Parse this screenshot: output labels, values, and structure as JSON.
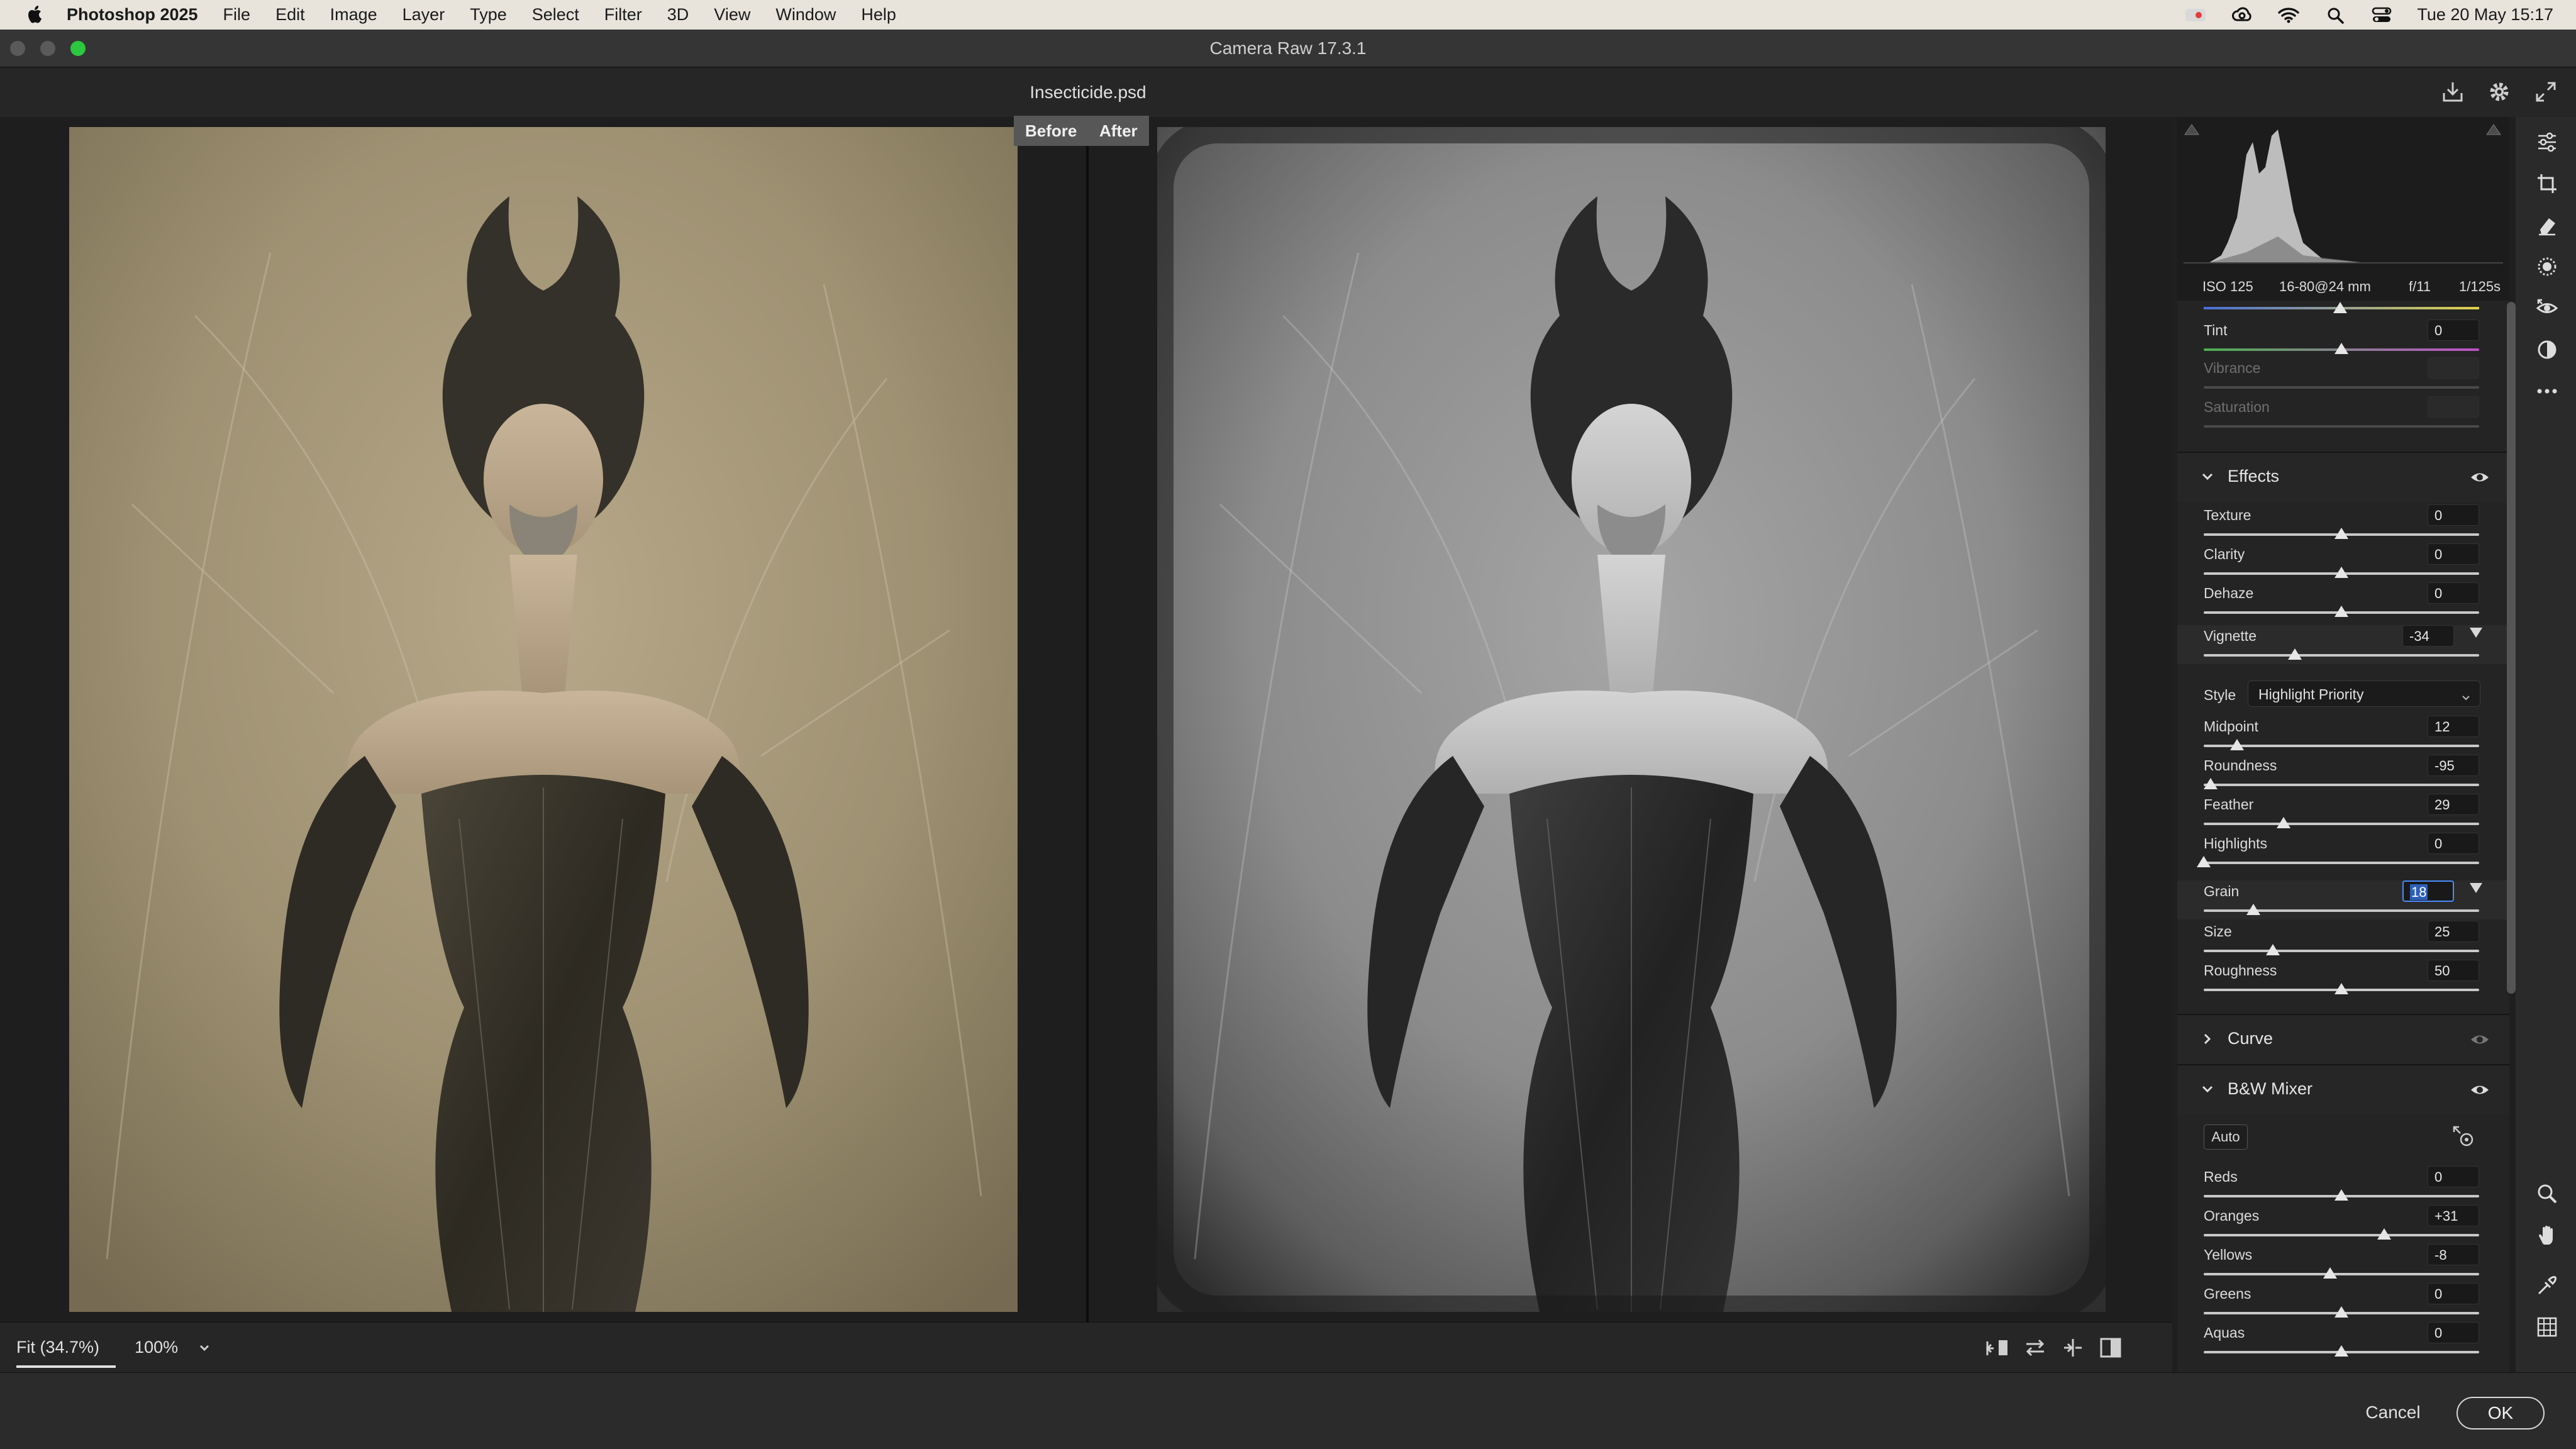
{
  "menubar": {
    "apple_icon": "apple-icon",
    "app_name": "Photoshop 2025",
    "items": [
      "File",
      "Edit",
      "Image",
      "Layer",
      "Type",
      "Select",
      "Filter",
      "3D",
      "View",
      "Window",
      "Help"
    ],
    "clock": "Tue 20 May  15:17"
  },
  "window": {
    "title": "Camera Raw 17.3.1"
  },
  "document": {
    "filename": "Insecticide.psd"
  },
  "compare": {
    "before": "Before",
    "after": "After"
  },
  "camera": {
    "iso": "ISO 125",
    "lens": "16-80@24 mm",
    "aperture": "f/11",
    "shutter": "1/125s"
  },
  "basic_tail": [
    {
      "label": "Tint",
      "value": "0",
      "position": 0.5,
      "enabled": true
    },
    {
      "label": "Vibrance",
      "value": "",
      "position": null,
      "enabled": false
    },
    {
      "label": "Saturation",
      "value": "",
      "position": null,
      "enabled": false
    }
  ],
  "effects": {
    "title": "Effects",
    "sliders": [
      {
        "label": "Texture",
        "value": "0",
        "position": 0.5
      },
      {
        "label": "Clarity",
        "value": "0",
        "position": 0.5
      },
      {
        "label": "Dehaze",
        "value": "0",
        "position": 0.5
      }
    ],
    "vignette": {
      "label": "Vignette",
      "value": "-34",
      "position": 0.33
    },
    "style": {
      "label": "Style",
      "value": "Highlight Priority"
    },
    "vignette_sub": [
      {
        "label": "Midpoint",
        "value": "12",
        "position": 0.12
      },
      {
        "label": "Roundness",
        "value": "-95",
        "position": 0.025
      },
      {
        "label": "Feather",
        "value": "29",
        "position": 0.29
      },
      {
        "label": "Highlights",
        "value": "0",
        "position": 0.0
      }
    ],
    "grain": {
      "label": "Grain",
      "value": "18",
      "position": 0.18
    },
    "grain_sub": [
      {
        "label": "Size",
        "value": "25",
        "position": 0.25
      },
      {
        "label": "Roughness",
        "value": "50",
        "position": 0.5
      }
    ]
  },
  "curve": {
    "title": "Curve"
  },
  "bw_mixer": {
    "title": "B&W Mixer",
    "auto": "Auto",
    "sliders": [
      {
        "label": "Reds",
        "value": "0",
        "position": 0.5
      },
      {
        "label": "Oranges",
        "value": "+31",
        "position": 0.655
      },
      {
        "label": "Yellows",
        "value": "-8",
        "position": 0.46
      },
      {
        "label": "Greens",
        "value": "0",
        "position": 0.5
      },
      {
        "label": "Aquas",
        "value": "0",
        "position": 0.5
      }
    ]
  },
  "zoom": {
    "fit": "Fit (34.7%)",
    "level": "100%"
  },
  "footer": {
    "cancel": "Cancel",
    "ok": "OK"
  }
}
